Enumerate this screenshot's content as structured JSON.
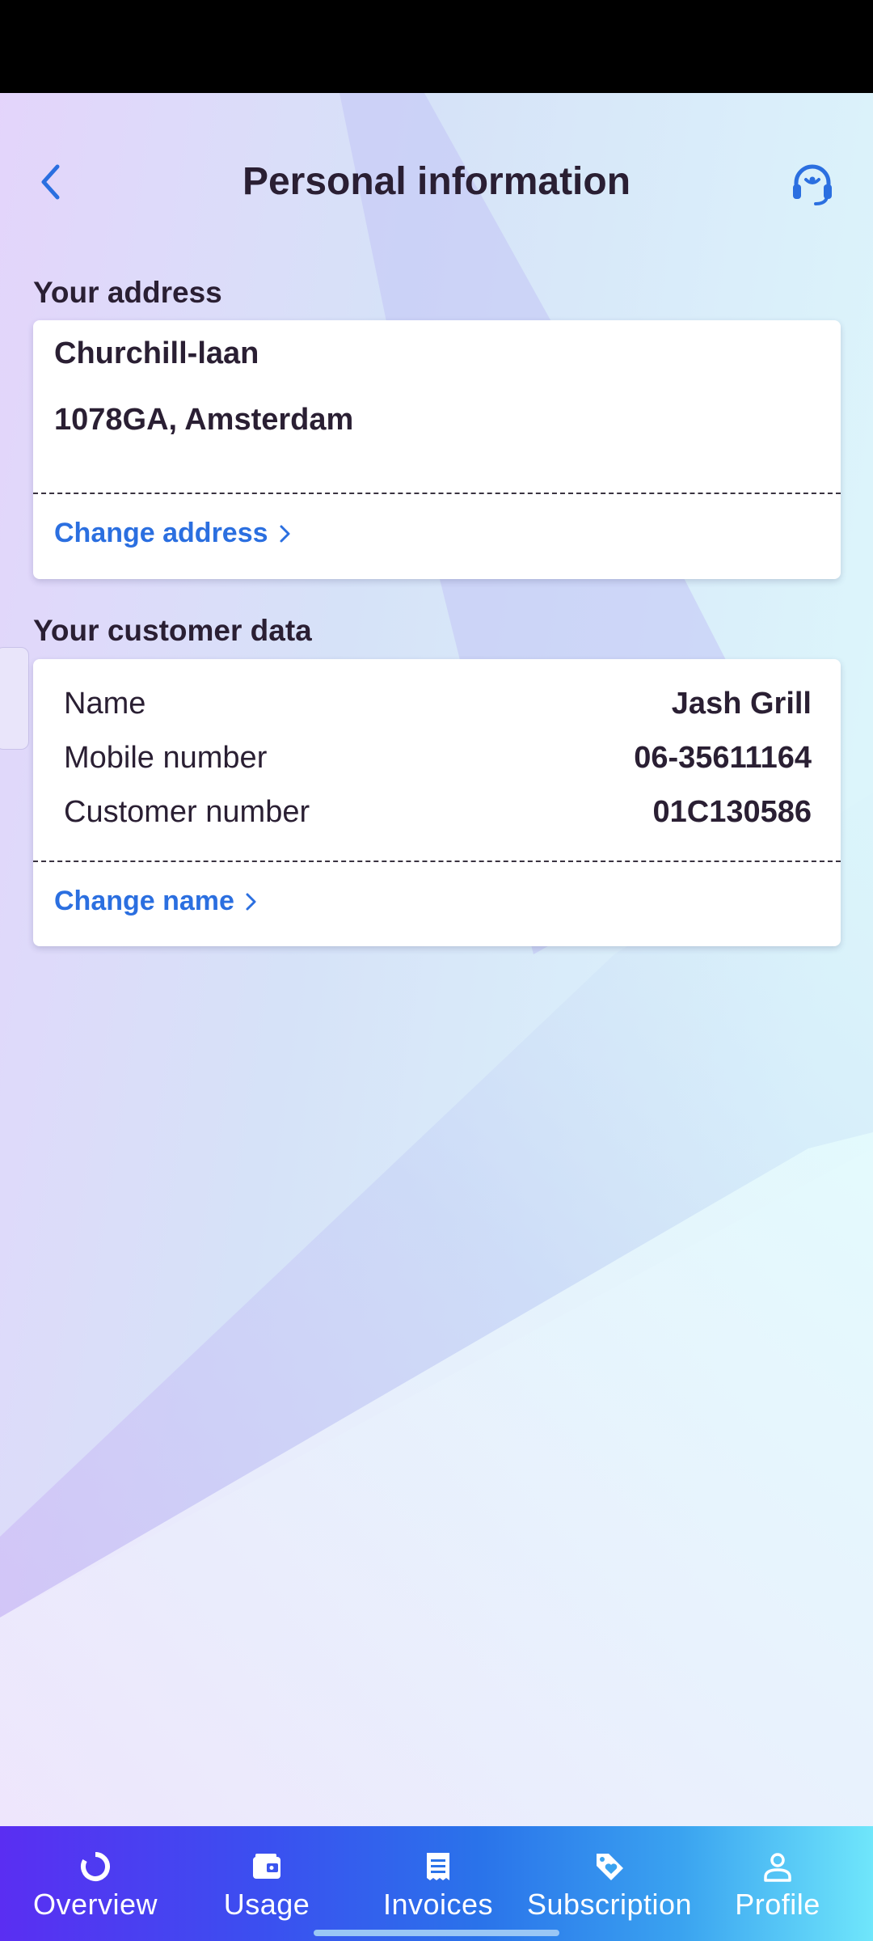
{
  "header": {
    "title": "Personal information"
  },
  "address": {
    "section_label": "Your address",
    "street": "Churchill-laan",
    "postal_city": "1078GA, Amsterdam",
    "change_link": "Change address"
  },
  "customer": {
    "section_label": "Your customer data",
    "rows": [
      {
        "label": "Name",
        "value": "Jash Grill"
      },
      {
        "label": "Mobile number",
        "value": "06-35611164"
      },
      {
        "label": "Customer number",
        "value": "01C130586"
      }
    ],
    "change_link": "Change name"
  },
  "nav": {
    "items": [
      {
        "label": "Overview",
        "icon": "overview-icon"
      },
      {
        "label": "Usage",
        "icon": "wallet-icon"
      },
      {
        "label": "Invoices",
        "icon": "invoice-icon"
      },
      {
        "label": "Subscription",
        "icon": "tag-icon"
      },
      {
        "label": "Profile",
        "icon": "person-icon"
      }
    ]
  },
  "colors": {
    "accent": "#2b6fe0",
    "text": "#2a1f33",
    "nav_start": "#5a2ef2",
    "nav_end": "#6fe6fb"
  }
}
